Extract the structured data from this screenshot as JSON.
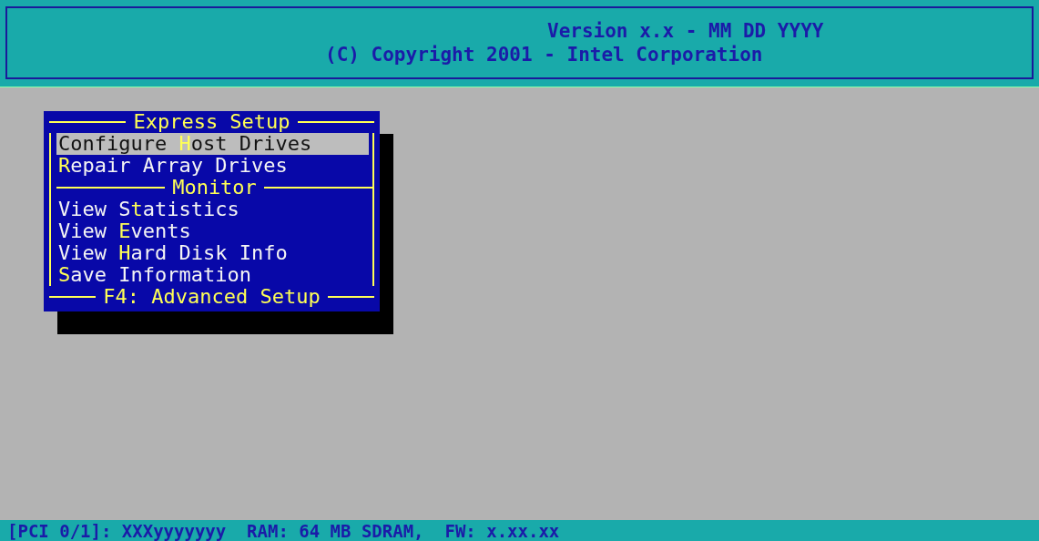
{
  "header": {
    "lines": [
      "Version x.x - MM DD YYYY",
      "(C) Copyright 2001 - Intel Corporation"
    ]
  },
  "menu": {
    "title": "Express Setup",
    "rows": [
      {
        "kind": "item",
        "prefix": "Configure ",
        "hotkey": "H",
        "suffix": "ost Drives",
        "selected": true
      },
      {
        "kind": "item",
        "prefix": "",
        "hotkey": "R",
        "suffix": "epair Array Drives",
        "selected": false
      },
      {
        "kind": "separator",
        "label": "Monitor"
      },
      {
        "kind": "item",
        "prefix": "View S",
        "hotkey": "t",
        "suffix": "atistics",
        "selected": false
      },
      {
        "kind": "item",
        "prefix": "View ",
        "hotkey": "E",
        "suffix": "vents",
        "selected": false
      },
      {
        "kind": "item",
        "prefix": "View ",
        "hotkey": "H",
        "suffix": "ard Disk Info",
        "selected": false
      },
      {
        "kind": "item",
        "prefix": "",
        "hotkey": "S",
        "suffix": "ave Information",
        "selected": false
      }
    ],
    "footer": "F4: Advanced Setup"
  },
  "status_bar": {
    "text": "[PCI 0/1]: XXXyyyyyyy  RAM: 64 MB SDRAM,  FW: x.xx.xx"
  }
}
